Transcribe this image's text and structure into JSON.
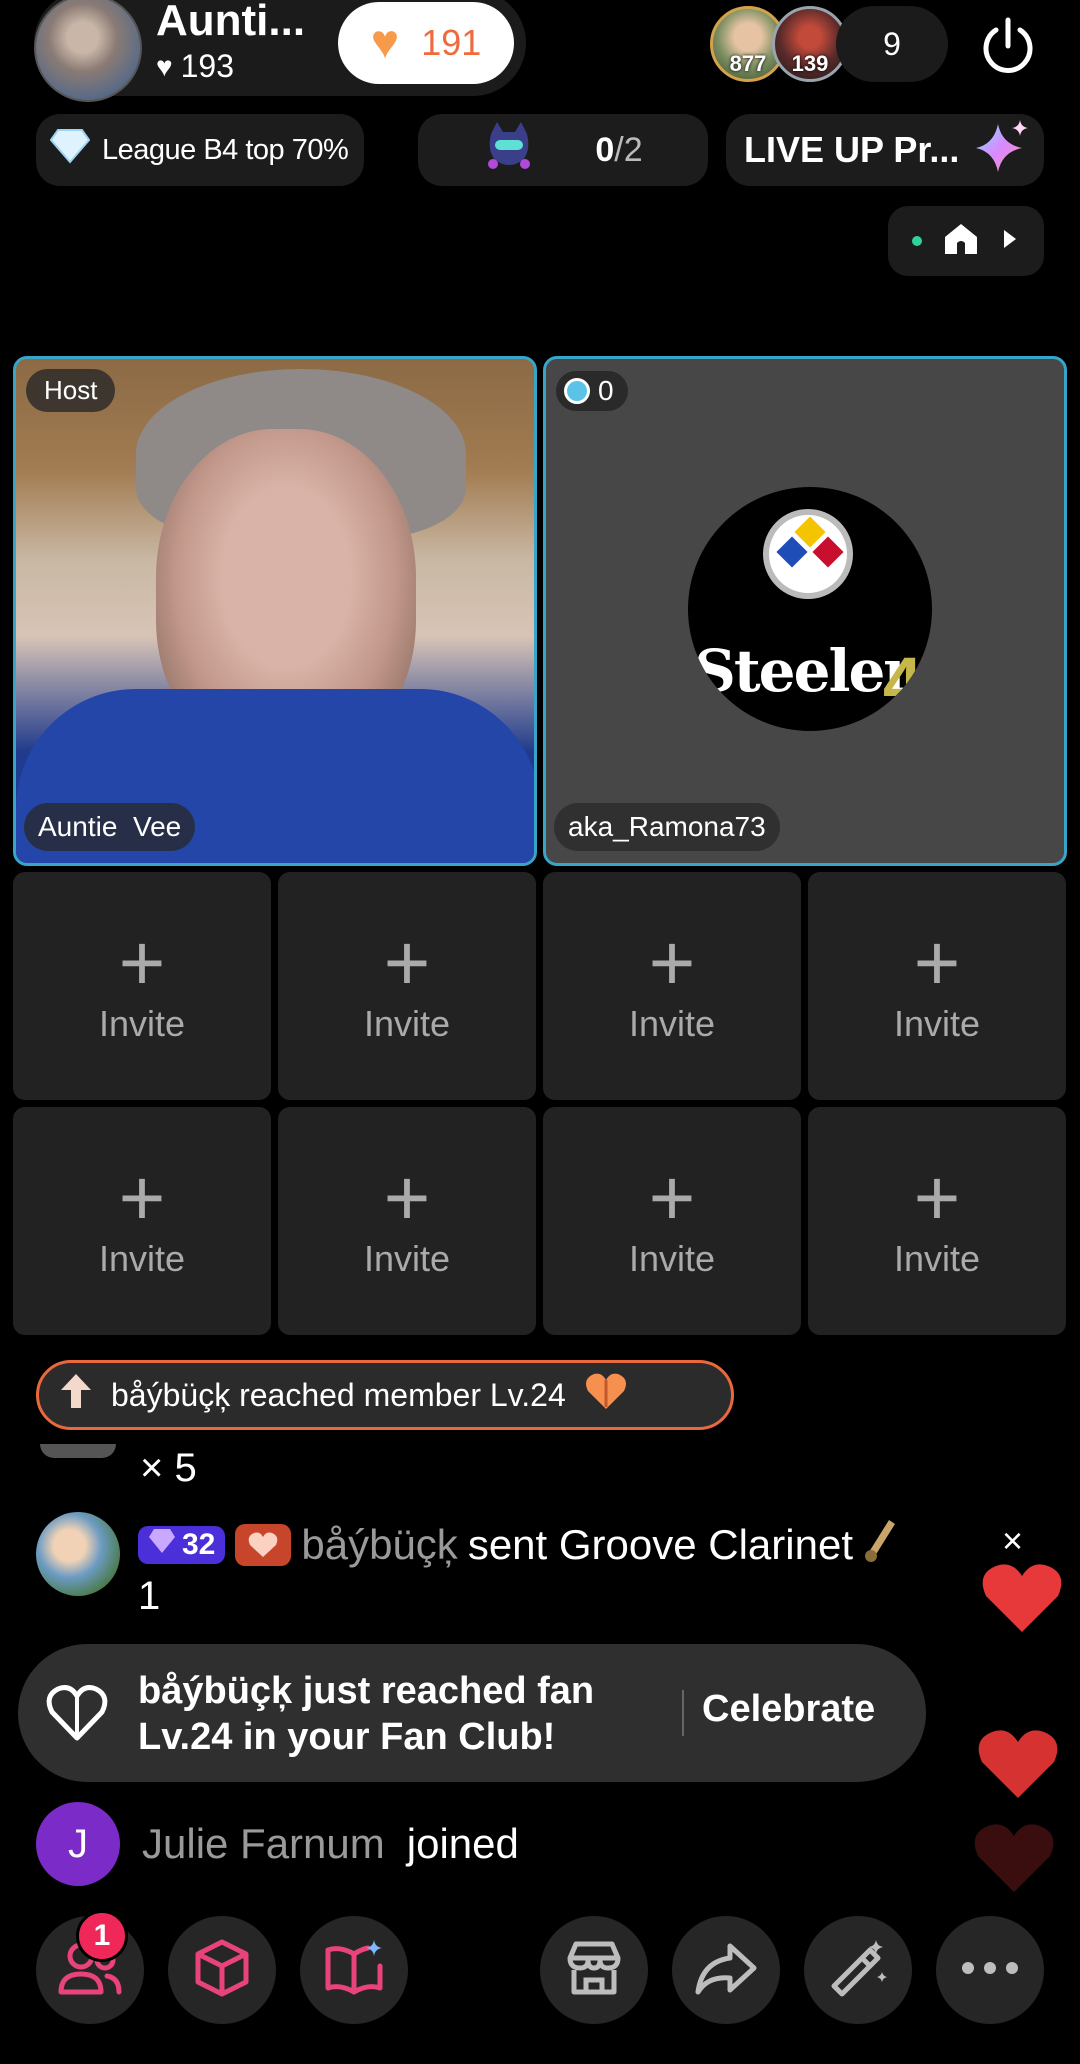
{
  "header": {
    "host_name": "Aunti...",
    "host_likes": "193",
    "like_count": "191",
    "viewers": [
      {
        "count": "877",
        "ring": "#d4a24a"
      },
      {
        "count": "139",
        "ring": "#9aa4ad"
      }
    ],
    "viewer_total": "9"
  },
  "pills": {
    "league": "League B4 top 70%",
    "challenge_done": "0",
    "challenge_total": "/2",
    "live_up": "LIVE UP Pr..."
  },
  "tiles": {
    "host_tag": "Host",
    "host_name": "Auntie  Vee",
    "guest_score": "0",
    "guest_name": "aka_Ramona73",
    "guest_logo_text": "Steeler"
  },
  "invite_label": "Invite",
  "chat": {
    "member_banner": "båýbüçķ reached member Lv.24",
    "multiplier": "× 5",
    "gift": {
      "level": "32",
      "user": "båýbüçķ",
      "text": "sent Groove Clarinet",
      "qty": "1",
      "close": "×"
    },
    "fan_toast": {
      "message": "båýbüçķ just reached fan Lv.24 in your Fan Club!",
      "action": "Celebrate"
    },
    "joined": {
      "initial": "J",
      "user": "Julie Farnum",
      "text": "joined"
    }
  },
  "toolbar": {
    "friends_badge": "1",
    "items": [
      "people-icon",
      "box-icon",
      "book-icon",
      "shop-icon",
      "share-icon",
      "magic-wand-icon",
      "more-icon"
    ]
  },
  "colors": {
    "accent_orange": "#e9693c",
    "tile_border": "#37a4c8",
    "heart_red": "#e8393a",
    "toolbar_pink": "#e8447a",
    "badge_red": "#f0285a"
  }
}
